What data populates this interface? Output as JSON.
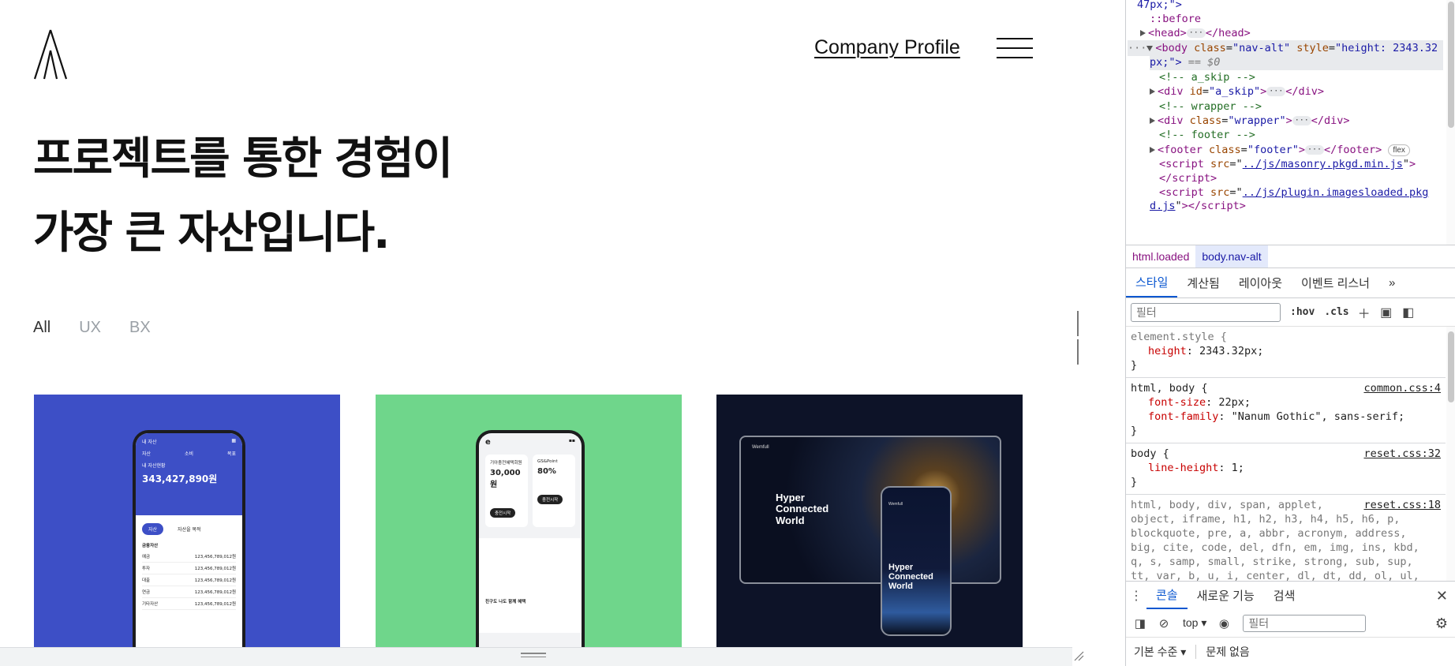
{
  "site": {
    "nav": {
      "company_profile": "Company Profile"
    },
    "hero": {
      "line1": "프로젝트를 통한 경험이",
      "line2": "가장 큰 자산입니다."
    },
    "filters": [
      "All",
      "UX",
      "BX"
    ],
    "card1": {
      "header": "내 자산",
      "tabs": [
        "자산",
        "소비",
        "목표"
      ],
      "label": "내 자산현황",
      "balance": "343,427,890원",
      "toggle": [
        "자산",
        "자산을 목적"
      ],
      "section": "금융자산",
      "rows": [
        [
          "예금",
          "123,456,789,012원"
        ],
        [
          "투자",
          "123,456,789,012원"
        ],
        [
          "대출",
          "123,456,789,012원"
        ],
        [
          "연금",
          "123,456,789,012원"
        ],
        [
          "기타자산",
          "123,456,789,012원"
        ]
      ]
    },
    "card2": {
      "card_a": {
        "title": "기아충전혜택회원",
        "value": "30,000원",
        "button": "충전시작"
      },
      "card_b": {
        "title": "GS&Point",
        "value": "80%",
        "button": "충전시작"
      },
      "lower_title": "친구도 나도 함께 혜택"
    },
    "card3": {
      "brand": "Wemfull",
      "title_lines": [
        "Hyper",
        "Connected",
        "World"
      ]
    }
  },
  "devtools": {
    "dom": {
      "l0": "47px;\">",
      "l1": "::before",
      "head_open": "<head>",
      "head_close": "</head>",
      "body_attr_name": "class",
      "body_attr_val": "\"nav-alt\"",
      "body_style_name": "style",
      "body_style_val": "\"height: 2343.32",
      "body_style_val2": "px;\">",
      "body_marker": "== $0",
      "c_skip": "<!-- a_skip -->",
      "div_skip_id": "\"a_skip\"",
      "c_wrapper": "<!-- wrapper -->",
      "div_wrapper_class": "\"wrapper\"",
      "c_footer": "<!-- footer -->",
      "footer_class": "\"footer\"",
      "flex_badge": "flex",
      "script1_src": "../js/masonry.pkgd.min.js",
      "script2_src": "../js/plugin.imagesloaded.pkg",
      "script2_src2": "d.js"
    },
    "breadcrumbs": [
      "html.loaded",
      "body.nav-alt"
    ],
    "tabs": [
      "스타일",
      "계산됨",
      "레이아웃",
      "이벤트 리스너"
    ],
    "filter_placeholder": "필터",
    "tools": [
      ":hov",
      ".cls"
    ],
    "rules": [
      {
        "selector": "element.style {",
        "source": "",
        "props": [
          [
            "height",
            "2343.32px;"
          ]
        ]
      },
      {
        "selector": "html, body {",
        "source": "common.css:4",
        "props": [
          [
            "font-size",
            "22px;"
          ],
          [
            "font-family",
            "\"Nanum Gothic\", sans-serif;"
          ]
        ]
      },
      {
        "selector": "body {",
        "source": "reset.css:32",
        "props": [
          [
            "line-height",
            "1;"
          ]
        ]
      }
    ],
    "reset_rule": {
      "source": "reset.css:18",
      "lines": [
        "html, body, div, span, applet,",
        "object, iframe, h1, h2, h3, h4, h5, h6, p,",
        "blockquote, pre, a, abbr, acronym, address,",
        "big, cite, code, del, dfn, em, img, ins, kbd,",
        "q, s, samp, small, strike, strong, sub, sup,",
        "tt, var, b, u, i, center, dl, dt, dd, ol, ul,"
      ]
    },
    "drawer_tabs": [
      "콘솔",
      "새로운 기능",
      "검색"
    ],
    "console": {
      "context": "top",
      "filter_placeholder": "필터",
      "level": "기본 수준",
      "issues": "문제 없음"
    }
  }
}
